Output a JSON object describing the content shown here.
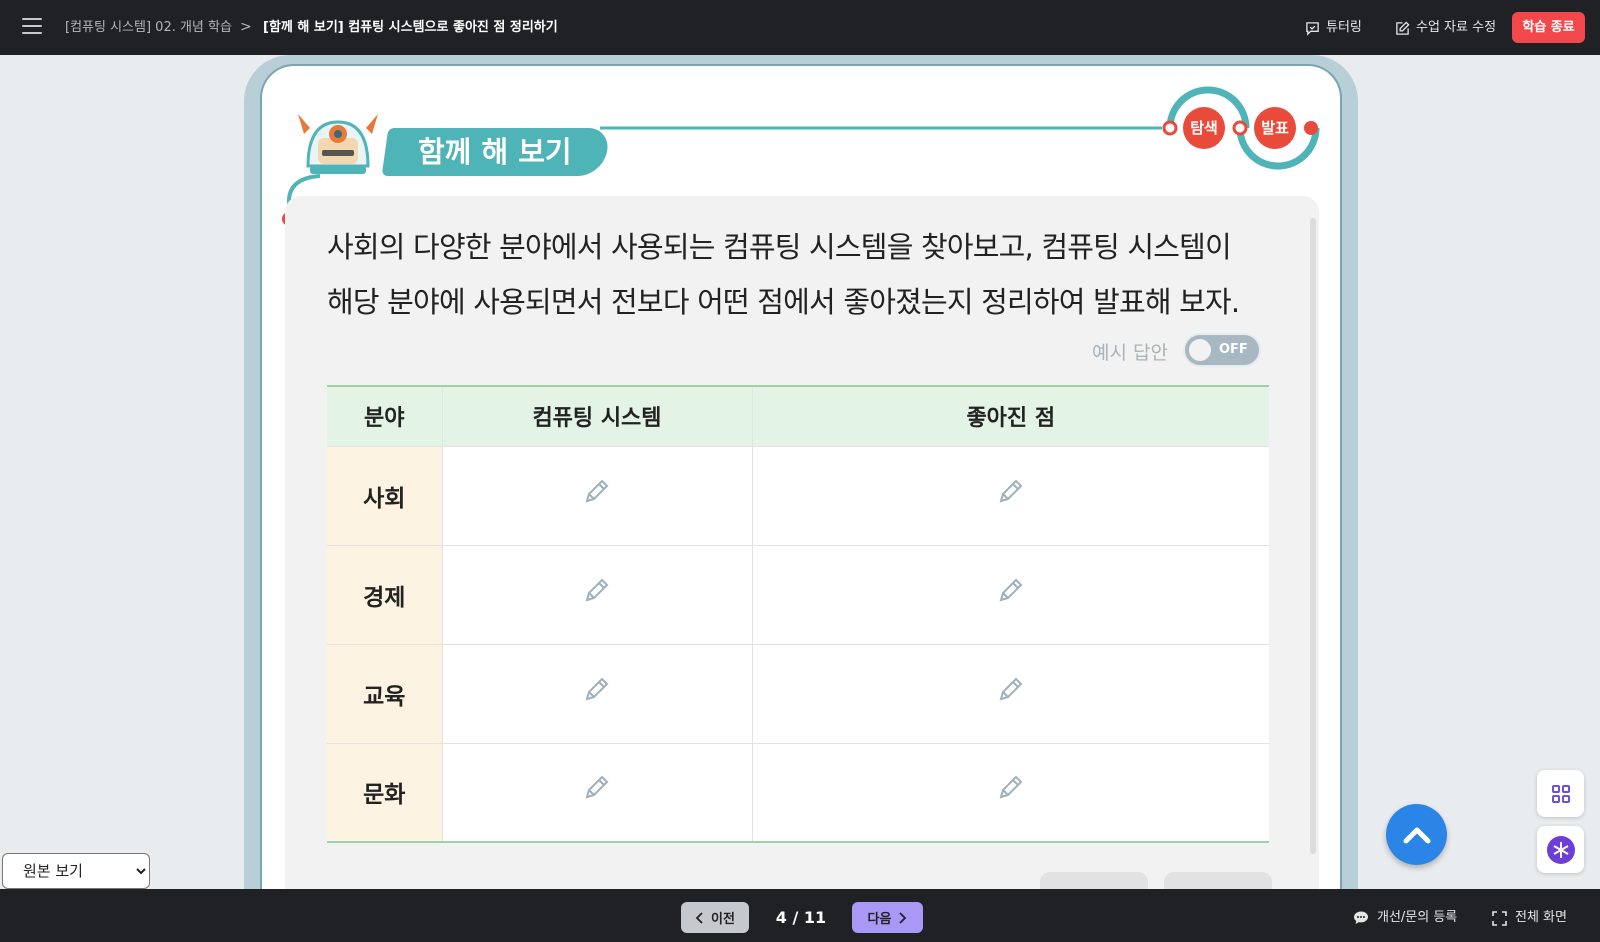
{
  "header": {
    "breadcrumb_parent": "[컴퓨팅 시스템] 02. 개념 학습",
    "breadcrumb_sep": ">",
    "breadcrumb_current": "[함께 해 보기] 컴퓨팅 시스템으로 좋아진 점 정리하기",
    "tutoring_label": "튜터링",
    "edit_material_label": "수업 자료 수정",
    "end_label": "학습 종료"
  },
  "activity": {
    "title": "함께 해 보기",
    "badge_explore": "탐색",
    "badge_present": "발표",
    "instruction_line1": "사회의 다양한 분야에서 사용되는 컴퓨팅 시스템을 찾아보고, 컴퓨팅 시스템이",
    "instruction_line2": "해당 분야에 사용되면서 전보다 어떤 점에서 좋아졌는지 정리하여 발표해 보자.",
    "example_answer_label": "예시 답안",
    "toggle_state": "OFF"
  },
  "table": {
    "headers": [
      "분야",
      "컴퓨팅 시스템",
      "좋아진 점"
    ],
    "rows": [
      "사회",
      "경제",
      "교육",
      "문화"
    ]
  },
  "footer": {
    "prev_label": "이전",
    "page_indicator": "4 / 11",
    "next_label": "다음",
    "feedback_label": "개선/문의 등록",
    "fullscreen_label": "전체 화면",
    "view_select": "원본 보기"
  },
  "colors": {
    "accent_teal": "#4fb4b8",
    "badge_red": "#e94a3a",
    "end_button": "#f2484c",
    "next_button": "#a998f5",
    "scroll_top": "#2b85e6"
  }
}
